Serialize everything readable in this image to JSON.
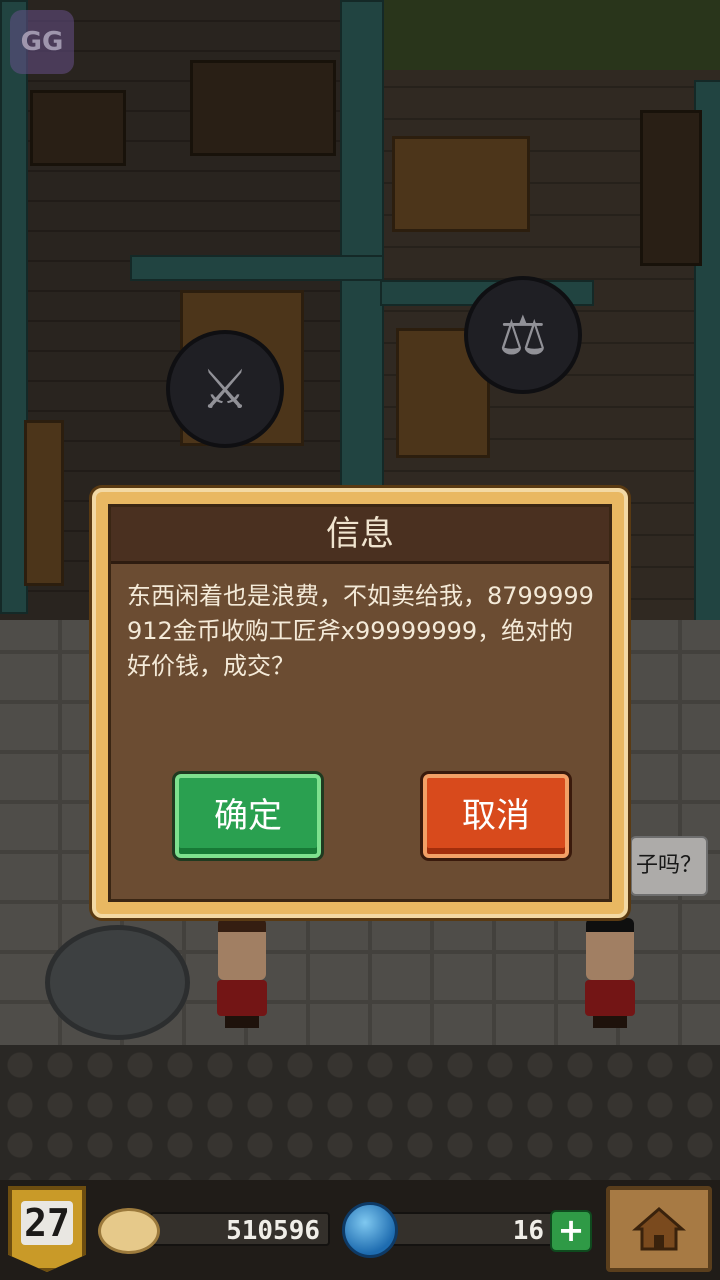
{
  "scene": {
    "speech_text": "子吗？",
    "overlay_logo": "GG",
    "icons": [
      "sword-bubble-icon",
      "scale-bubble-icon"
    ]
  },
  "dialog": {
    "title": "信息",
    "message": "东西闲着也是浪费，不如卖给我，8799999912金币收购工匠斧x99999999，绝对的好价钱，成交？",
    "confirm_label": "确定",
    "cancel_label": "取消"
  },
  "hud": {
    "level": "27",
    "gold": "510596",
    "gems": "16",
    "plus_label": "+",
    "colors": {
      "confirm": "#2aa050",
      "cancel": "#d84a1c",
      "level_badge": "#c99a28"
    }
  }
}
